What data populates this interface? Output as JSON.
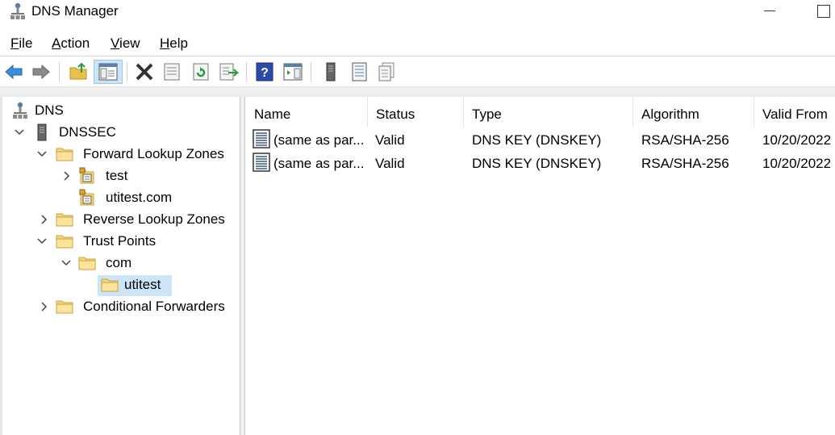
{
  "window": {
    "title": "DNS Manager"
  },
  "menu": {
    "file": {
      "accel": "F",
      "rest": "ile"
    },
    "action": {
      "accel": "A",
      "rest": "ction"
    },
    "view": {
      "accel": "V",
      "rest": "iew"
    },
    "help": {
      "accel": "H",
      "rest": "elp"
    }
  },
  "toolbar": {
    "buttons": [
      "back-arrow-icon",
      "forward-arrow-icon",
      "up-folder-icon",
      "show-hide-console-tree-icon",
      "delete-icon",
      "properties-icon",
      "refresh-icon",
      "export-list-icon",
      "help-icon",
      "show-hide-action-pane-icon",
      "server-icon",
      "zone-records-icon",
      "zone-copy-icon"
    ]
  },
  "tree": {
    "root": "DNS",
    "server": "DNSSEC",
    "forward_lookup": "Forward Lookup Zones",
    "zone_test": "test",
    "zone_utitest": "utitest.com",
    "reverse_lookup": "Reverse Lookup Zones",
    "trust_points": "Trust Points",
    "tp_com": "com",
    "tp_utitest": "utitest",
    "conditional_forwarders": "Conditional Forwarders"
  },
  "list": {
    "columns": [
      "Name",
      "Status",
      "Type",
      "Algorithm",
      "Valid From"
    ],
    "rows": [
      {
        "name": "(same as par...",
        "status": "Valid",
        "type": "DNS KEY (DNSKEY)",
        "algorithm": "RSA/SHA-256",
        "valid_from": "10/20/2022"
      },
      {
        "name": "(same as par...",
        "status": "Valid",
        "type": "DNS KEY (DNSKEY)",
        "algorithm": "RSA/SHA-256",
        "valid_from": "10/20/2022"
      }
    ]
  }
}
